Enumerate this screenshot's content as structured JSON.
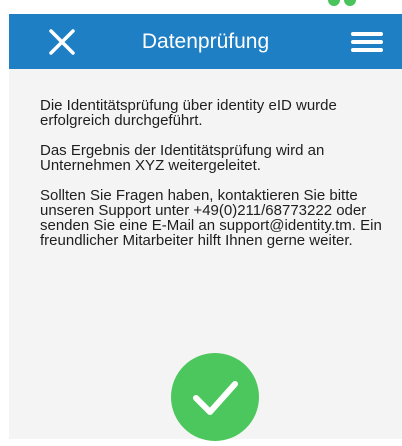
{
  "header": {
    "title": "Datenprüfung",
    "close_icon": "close-icon",
    "menu_icon": "hamburger-menu-icon",
    "background_color": "#1f7fc4"
  },
  "content": {
    "paragraphs": [
      "Die Identitätsprüfung über identity eID wurde erfolgreich durchgeführt.",
      "Das Ergebnis der Identitätsprüfung wird an Unternehmen XYZ weitergeleitet.",
      "Sollten Sie Fragen haben, kontaktieren Sie bitte unseren Support unter +49(0)211/68773222 oder senden Sie eine E-Mail an support@identity.tm. Ein freundlicher Mitarbeiter hilft Ihnen gerne weiter."
    ]
  },
  "status": {
    "icon": "checkmark-success-icon",
    "color": "#4cc75d"
  }
}
